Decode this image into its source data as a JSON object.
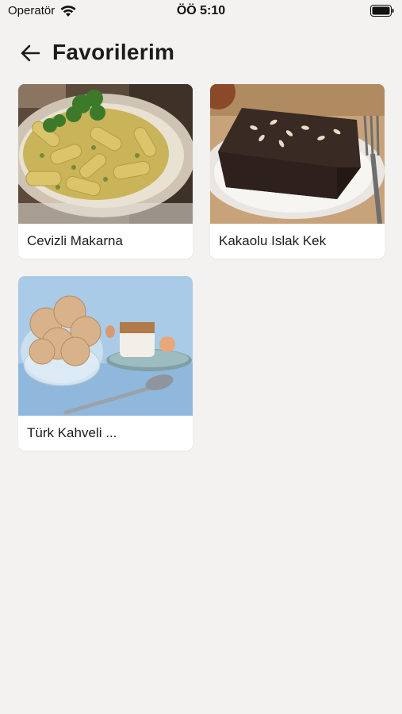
{
  "status_bar": {
    "carrier": "Operatör",
    "time": "ÖÖ 5:10",
    "icons": [
      "wifi-icon",
      "battery-icon"
    ]
  },
  "header": {
    "back_icon": "arrow-left-icon",
    "title": "Favorilerim"
  },
  "favorites": [
    {
      "name": "Cevizli Makarna",
      "image": "pasta-photo"
    },
    {
      "name": "Kakaolu Islak Kek",
      "image": "cake-photo"
    },
    {
      "name": "Türk Kahveli ...",
      "image": "ice-cream-photo"
    }
  ],
  "colors": {
    "background": "#f4f2f1",
    "card": "#ffffff",
    "text": "#1c1c1c"
  }
}
